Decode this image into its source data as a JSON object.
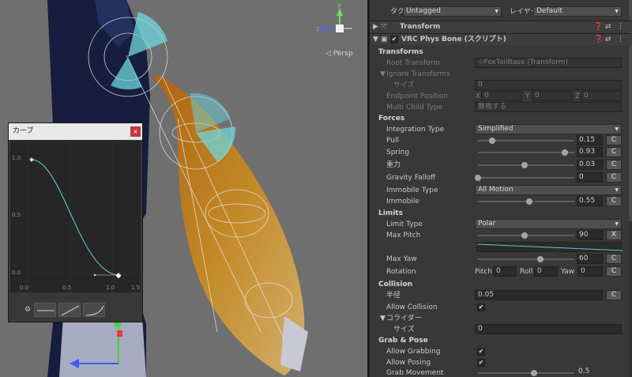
{
  "scene": {
    "persp_label": "◁ Persp",
    "gizmo": {
      "y": "y",
      "x": "x",
      "z": "z"
    }
  },
  "curve": {
    "title": "カーブ",
    "close": "×",
    "y_ticks": [
      "1.0",
      "0.5",
      "0.0"
    ],
    "x_ticks": [
      "0.0",
      "0.5",
      "1.0",
      "1.5"
    ],
    "points": [
      [
        0.0,
        1.0
      ],
      [
        1.0,
        0.0
      ]
    ]
  },
  "inspector": {
    "top": {
      "tag_label": "タグ",
      "tag_value": "Untagged",
      "layer_label": "レイヤー",
      "layer_value": "Default"
    },
    "transform_header": "Transform",
    "component_header": "VRC Phys Bone (スクリプト)",
    "sections": {
      "transforms": "Transforms",
      "forces": "Forces",
      "limits": "Limits",
      "collision": "Collision",
      "grab": "Grab & Pose"
    },
    "root_transform": {
      "label": "Root Transform",
      "value": "⊹FoxTailBase (Transform)"
    },
    "ignore_transforms": {
      "label": "Ignore Transforms",
      "size_label": "サイズ",
      "size_value": "0"
    },
    "endpoint": {
      "label": "Endpoint Position",
      "x_label": "X",
      "x": "0",
      "y_label": "Y",
      "y": "0",
      "z_label": "Z",
      "z": "0"
    },
    "multi_child": {
      "label": "Multi Child Type",
      "value": "無視する"
    },
    "integration": {
      "label": "Integration Type",
      "value": "Simplified"
    },
    "pull": {
      "label": "Pull",
      "value": "0.15",
      "level": 0.15
    },
    "spring": {
      "label": "Spring",
      "value": "0.93",
      "level": 0.93
    },
    "gravity": {
      "label": "重力",
      "value": "0.03",
      "level": 0.5
    },
    "gravity_falloff": {
      "label": "Gravity Falloff",
      "value": "0",
      "level": 0.0
    },
    "immobile_type": {
      "label": "Immobile Type",
      "value": "All Motion"
    },
    "immobile": {
      "label": "Immobile",
      "value": "0.55",
      "level": 0.55
    },
    "limit_type": {
      "label": "Limit Type",
      "value": "Polar"
    },
    "max_pitch": {
      "label": "Max Pitch",
      "value": "90",
      "level": 0.5
    },
    "max_yaw": {
      "label": "Max Yaw",
      "value": "60",
      "level": 0.67
    },
    "rotation": {
      "label": "Rotation",
      "pitch_label": "Pitch",
      "pitch": "0",
      "roll_label": "Roll",
      "roll": "0",
      "yaw_label": "Yaw",
      "yaw": "0"
    },
    "radius": {
      "label": "半径",
      "value": "0.05"
    },
    "allow_collision": {
      "label": "Allow Collision",
      "checked": "✔"
    },
    "colliders": {
      "label": "コライダー",
      "size_label": "サイズ",
      "size_value": "0"
    },
    "allow_grabbing": {
      "label": "Allow Grabbing",
      "checked": "✔"
    },
    "allow_posing": {
      "label": "Allow Posing",
      "checked": "✔"
    },
    "grab_movement": {
      "label": "Grab Movement",
      "value": "0.5"
    },
    "c_button": "C",
    "x_button": "X"
  }
}
